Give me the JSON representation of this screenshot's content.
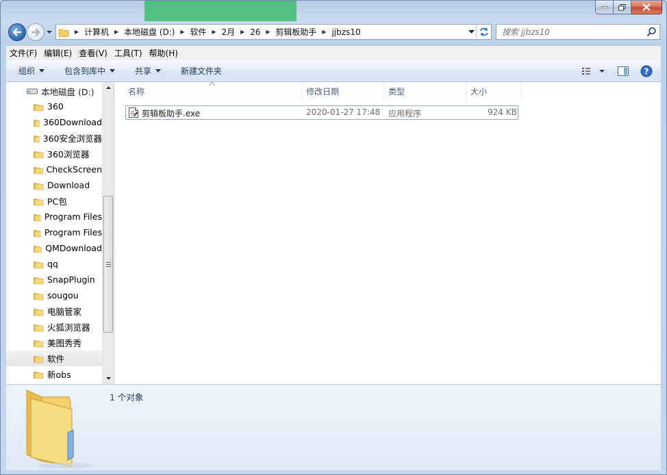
{
  "window": {
    "caption_buttons": [
      "minimize",
      "maximize",
      "close"
    ]
  },
  "address_bar": {
    "crumbs": [
      "计算机",
      "本地磁盘 (D:)",
      "软件",
      "2月",
      "26",
      "剪辑板助手",
      "jjbzs10"
    ]
  },
  "search": {
    "placeholder": "搜索 jjbzs10"
  },
  "menu": {
    "items": [
      "文件(F)",
      "编辑(E)",
      "查看(V)",
      "工具(T)",
      "帮助(H)"
    ]
  },
  "command_bar": {
    "organize": "组织",
    "include_in_library": "包含到库中",
    "share": "共享",
    "new_folder": "新建文件夹"
  },
  "nav_tree": {
    "drive": "本地磁盘 (D:)",
    "items": [
      "360",
      "360Download",
      "360安全浏览器",
      "360浏览器",
      "CheckScreen",
      "Download",
      "PC包",
      "Program Files",
      "Program Files",
      "QMDownload",
      "qq",
      "SnapPlugin",
      "sougou",
      "电脑管家",
      "火狐浏览器",
      "美图秀秀",
      "软件",
      "新obs"
    ],
    "selected": "软件"
  },
  "columns": {
    "name": "名称",
    "date": "修改日期",
    "type": "类型",
    "size": "大小"
  },
  "files": [
    {
      "name": "剪辑板助手.exe",
      "date": "2020-01-27 17:48",
      "type": "应用程序",
      "size": "924 KB"
    }
  ],
  "details_pane": {
    "count": "1 个对象"
  },
  "colors": {
    "accent": "#1e395b",
    "selection_border": "#84acdd",
    "folder_yellow": "#f5d77a"
  }
}
